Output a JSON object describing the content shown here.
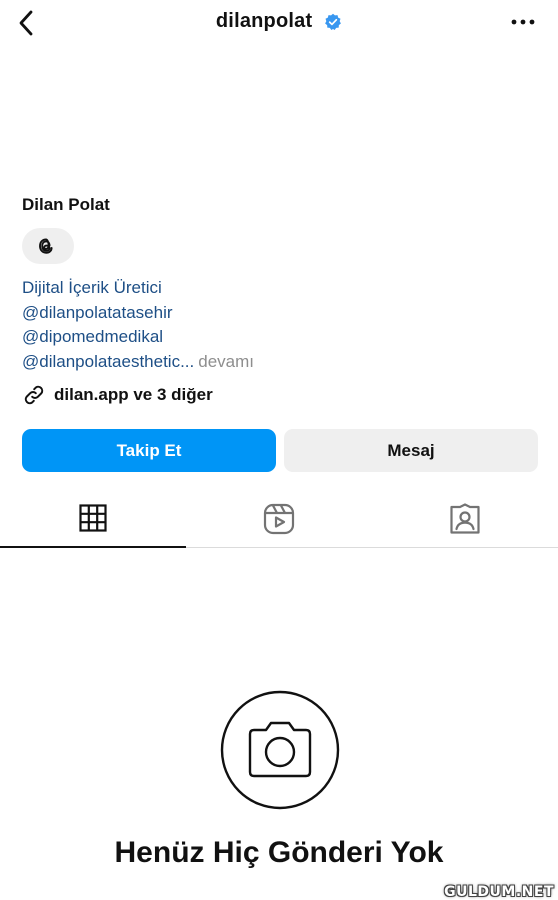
{
  "header": {
    "username": "dilanpolat",
    "back_icon": "chevron-left-icon",
    "verified_icon": "verified-badge-icon",
    "verified_color": "#3897f0",
    "more_icon": "more-horizontal-icon"
  },
  "profile": {
    "display_name": "Dilan Polat",
    "threads_icon": "threads-icon",
    "bio": {
      "category": "Dijital İçerik Üretici",
      "lines": [
        "@dilanpolatatasehir",
        "@dipomedmedikal",
        "@dilanpolataesthetic..."
      ],
      "more_label": "devamı",
      "link_color": "#1e4f86"
    },
    "links": {
      "icon": "link-icon",
      "text": "dilan.app ve 3 diğer"
    }
  },
  "actions": {
    "follow_label": "Takip Et",
    "follow_color": "#0095f6",
    "message_label": "Mesaj"
  },
  "tabs": [
    {
      "icon": "grid-icon",
      "active": true
    },
    {
      "icon": "reels-icon",
      "active": false
    },
    {
      "icon": "tagged-icon",
      "active": false
    }
  ],
  "empty_state": {
    "icon": "camera-icon",
    "title": "Henüz Hiç Gönderi Yok"
  },
  "watermark": "GULDUM.NET"
}
